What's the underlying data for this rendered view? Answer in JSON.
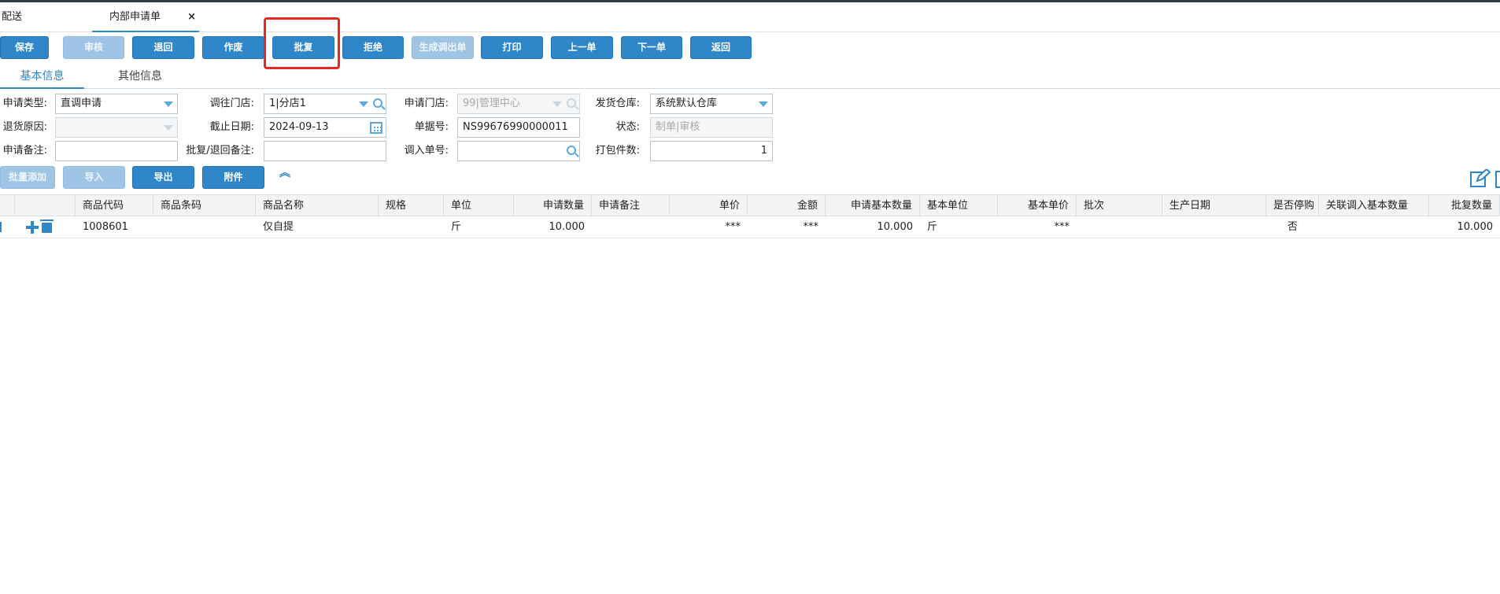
{
  "tabs": {
    "tab1_label": "配送",
    "tab2_label": "内部申请单",
    "close_glyph": "×"
  },
  "toolbar": {
    "buttons": [
      {
        "label": "保存",
        "enabled": true
      },
      {
        "label": "审核",
        "enabled": false
      },
      {
        "label": "退回",
        "enabled": true
      },
      {
        "label": "作废",
        "enabled": true
      },
      {
        "label": "批复",
        "enabled": true
      },
      {
        "label": "拒绝",
        "enabled": true
      },
      {
        "label": "生成调出单",
        "enabled": false
      },
      {
        "label": "打印",
        "enabled": true
      },
      {
        "label": "上一单",
        "enabled": true
      },
      {
        "label": "下一单",
        "enabled": true
      },
      {
        "label": "返回",
        "enabled": true
      }
    ]
  },
  "subtabs": {
    "basic": "基本信息",
    "other": "其他信息"
  },
  "form": {
    "apply_type_label": "申请类型:",
    "apply_type_value": "直调申请",
    "to_store_label": "调往门店:",
    "to_store_value": "1|分店1",
    "apply_store_label": "申请门店:",
    "apply_store_value": "99|管理中心",
    "warehouse_label": "发货仓库:",
    "warehouse_value": "系统默认仓库",
    "return_reason_label": "退货原因:",
    "return_reason_value": "",
    "deadline_label": "截止日期:",
    "deadline_value": "2024-09-13",
    "doc_no_label": "单据号:",
    "doc_no_value": "NS99676990000011",
    "status_label": "状态:",
    "status_value": "制单|审核",
    "remark_label": "申请备注:",
    "remark_value": "",
    "reply_remark_label": "批复/退回备注:",
    "reply_remark_value": "",
    "in_doc_label": "调入单号:",
    "in_doc_value": "",
    "pack_count_label": "打包件数:",
    "pack_count_value": "1"
  },
  "toolbar2": {
    "batch_add": "批量添加",
    "import": "导入",
    "export": "导出",
    "attachment": "附件",
    "collapse_glyph": "︽"
  },
  "grid": {
    "headers": [
      "商品代码",
      "商品条码",
      "商品名称",
      "规格",
      "单位",
      "申请数量",
      "申请备注",
      "单价",
      "金额",
      "申请基本数量",
      "基本单位",
      "基本单价",
      "批次",
      "生产日期",
      "是否停购",
      "关联调入基本数量",
      "批复数量"
    ],
    "rows": [
      {
        "code": "1008601",
        "barcode": "",
        "name": "仅自提",
        "spec": "",
        "unit": "斤",
        "apply_qty": "10.000",
        "apply_remark": "",
        "price": "***",
        "amount": "***",
        "base_qty": "10.000",
        "base_unit": "斤",
        "base_price": "***",
        "batch": "",
        "prod_date": "",
        "stopped": "否",
        "linked_qty": "",
        "reply_qty": "10.000"
      }
    ]
  },
  "colors": {
    "accent": "#2f86c9",
    "highlight": "#e8281e"
  }
}
